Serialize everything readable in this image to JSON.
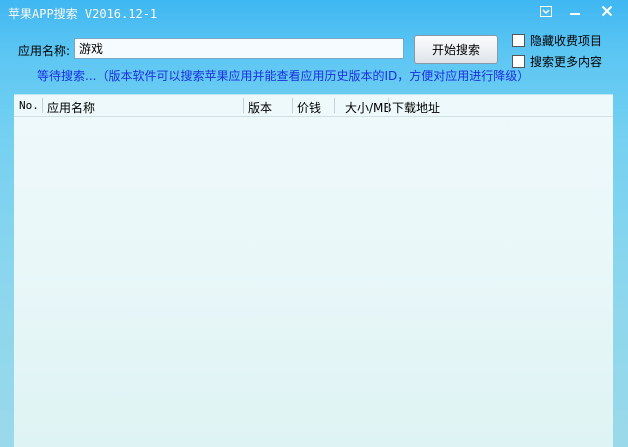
{
  "window": {
    "title": "苹果APP搜索 V2016.12-1"
  },
  "search": {
    "label": "应用名称:",
    "value": "游戏",
    "button_label": "开始搜索"
  },
  "options": {
    "hide_paid_label": "隐藏收费项目",
    "search_more_label": "搜索更多内容"
  },
  "status": {
    "text": "等待搜索...（版本软件可以搜索苹果应用并能查看应用历史版本的ID，方便对应用进行降级）"
  },
  "list": {
    "columns": [
      "No.",
      "应用名称",
      "版本",
      "价钱",
      "大小/MB",
      "下载地址"
    ]
  },
  "colors": {
    "status_text": "#1a2fe0",
    "title_bar": "#3fb7f2"
  }
}
